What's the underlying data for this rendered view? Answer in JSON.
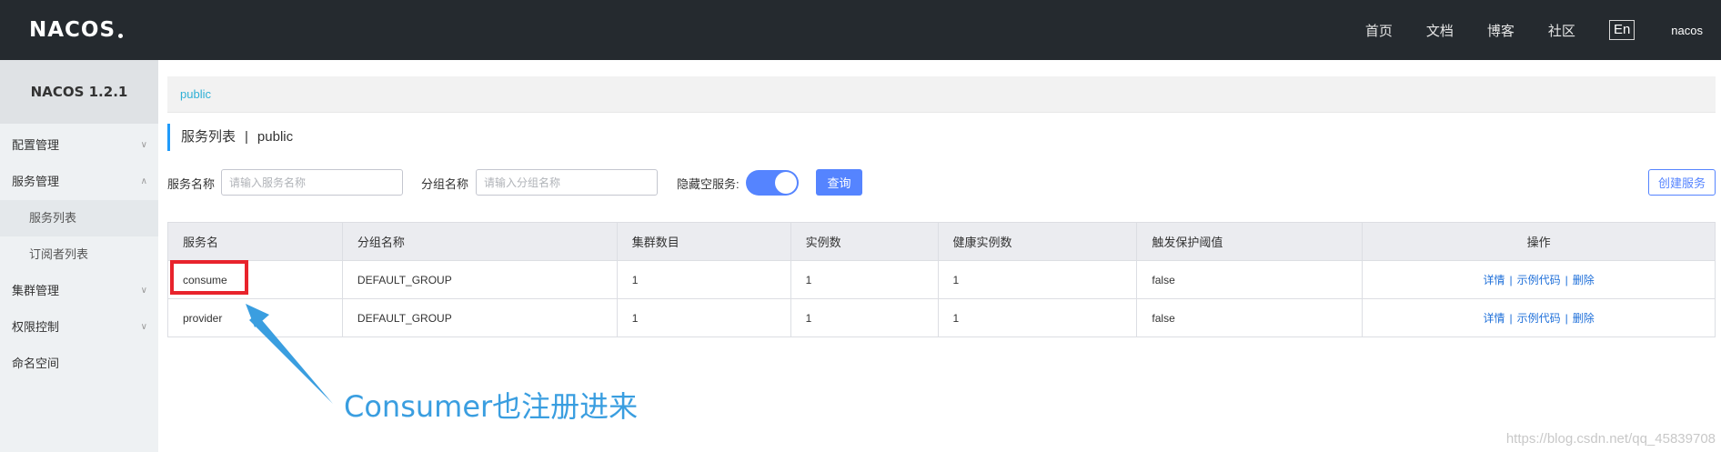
{
  "topbar": {
    "logo_text": "NACOS",
    "nav": [
      "首页",
      "文档",
      "博客",
      "社区"
    ],
    "lang": "En",
    "user": "nacos"
  },
  "sidebar": {
    "title": "NACOS 1.2.1",
    "items": [
      {
        "label": "配置管理",
        "expanded": false
      },
      {
        "label": "服务管理",
        "expanded": true
      },
      {
        "label": "服务列表",
        "sub": true
      },
      {
        "label": "订阅者列表",
        "sub": true
      },
      {
        "label": "集群管理",
        "expanded": false
      },
      {
        "label": "权限控制",
        "expanded": false
      },
      {
        "label": "命名空间"
      }
    ]
  },
  "breadcrumb": "public",
  "page_title": {
    "title": "服务列表",
    "sep": "|",
    "namespace": "public"
  },
  "filters": {
    "service_label": "服务名称",
    "service_placeholder": "请输入服务名称",
    "group_label": "分组名称",
    "group_placeholder": "请输入分组名称",
    "hide_empty_label": "隐藏空服务:",
    "query_label": "查询",
    "create_label": "创建服务"
  },
  "table": {
    "headers": [
      "服务名",
      "分组名称",
      "集群数目",
      "实例数",
      "健康实例数",
      "触发保护阈值",
      "操作"
    ],
    "rows": [
      {
        "name": "consume",
        "group": "DEFAULT_GROUP",
        "clusters": "1",
        "instances": "1",
        "healthy": "1",
        "threshold": "false"
      },
      {
        "name": "provider",
        "group": "DEFAULT_GROUP",
        "clusters": "1",
        "instances": "1",
        "healthy": "1",
        "threshold": "false"
      }
    ],
    "ops": {
      "detail": "详情",
      "sample": "示例代码",
      "delete": "删除",
      "sep": "|"
    }
  },
  "annotation": "Consumer也注册进来",
  "watermark": "https://blog.csdn.net/qq_45839708",
  "colors": {
    "accent": "#5584ff",
    "topbar": "#252a2f",
    "highlight": "#e8232c",
    "annotation": "#3a9ee0"
  }
}
